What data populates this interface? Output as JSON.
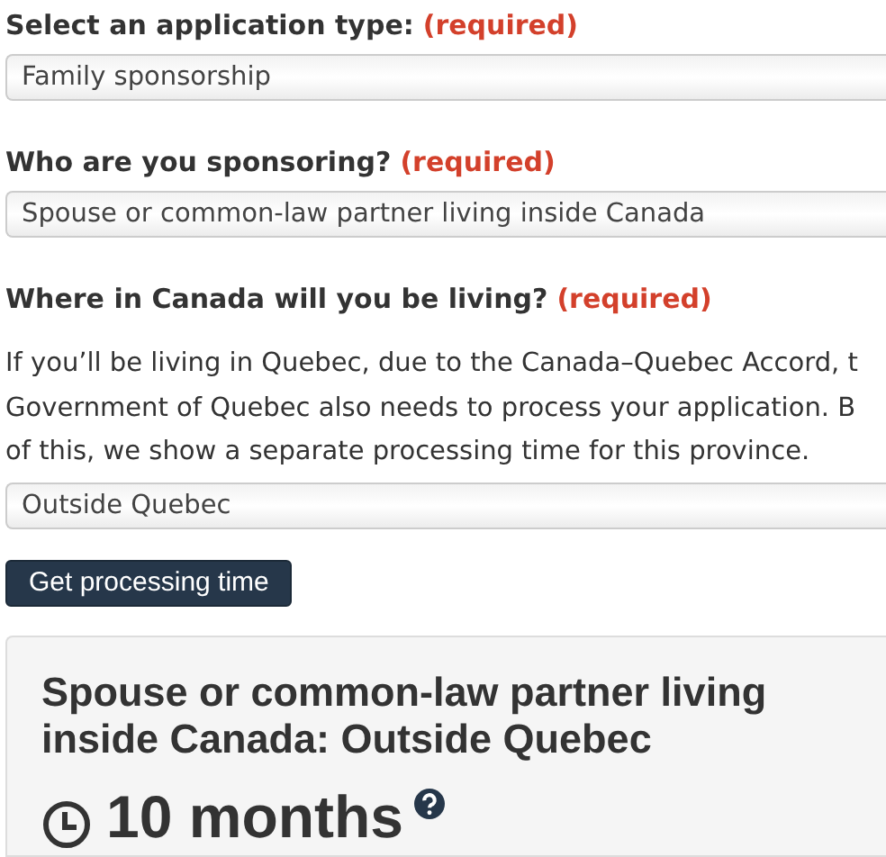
{
  "fields": [
    {
      "label": "Select an application type:",
      "required": "(required)",
      "value": "Family sponsorship"
    },
    {
      "label": "Who are you sponsoring?",
      "required": "(required)",
      "value": "Spouse or common-law partner living inside Canada"
    },
    {
      "label": "Where in Canada will you be living?",
      "required": "(required)",
      "help_lines": [
        "If you’ll be living in Quebec, due to the Canada–Quebec Accord, t",
        "Government of Quebec also needs to process your application. B",
        "of this, we show a separate processing time for this province."
      ],
      "value": "Outside Quebec"
    }
  ],
  "button": "Get processing time",
  "result": {
    "title": "Spouse or common-law partner living inside Canada: Outside Quebec",
    "time": "10 months"
  }
}
